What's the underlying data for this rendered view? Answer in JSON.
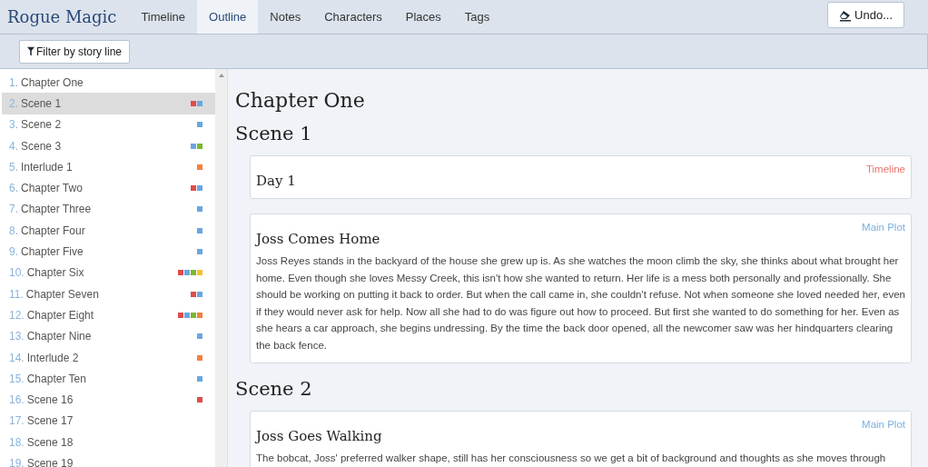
{
  "app": {
    "title": "Rogue Magic"
  },
  "tabs": [
    {
      "label": "Timeline",
      "selected": false
    },
    {
      "label": "Outline",
      "selected": true
    },
    {
      "label": "Notes",
      "selected": false
    },
    {
      "label": "Characters",
      "selected": false
    },
    {
      "label": "Places",
      "selected": false
    },
    {
      "label": "Tags",
      "selected": false
    }
  ],
  "undo_button": {
    "label": "Undo..."
  },
  "filter_button": {
    "label": "Filter by story line"
  },
  "outline": [
    {
      "number": "1.",
      "title": "Chapter One",
      "selected": false
    },
    {
      "number": "2.",
      "title": "Scene 1",
      "selected": true,
      "tags": [
        {
          "color": "#e04b4b"
        },
        {
          "color": "#6aa6e0"
        }
      ]
    },
    {
      "number": "3.",
      "title": "Scene 2",
      "selected": false,
      "tags": [
        {
          "color": "#6aa6e0"
        }
      ]
    },
    {
      "number": "4.",
      "title": "Scene 3",
      "selected": false,
      "tags": [
        {
          "color": "#6aa6e0"
        },
        {
          "color": "#7ab82e"
        }
      ]
    },
    {
      "number": "5.",
      "title": "Interlude 1",
      "selected": false,
      "tags": [
        {
          "color": "#f5803e"
        }
      ]
    },
    {
      "number": "6.",
      "title": "Chapter Two",
      "selected": false,
      "tags": [
        {
          "color": "#e04b4b"
        },
        {
          "color": "#6aa6e0"
        }
      ]
    },
    {
      "number": "7.",
      "title": "Chapter Three",
      "selected": false,
      "tags": [
        {
          "color": "#6aa6e0"
        }
      ]
    },
    {
      "number": "8.",
      "title": "Chapter Four",
      "selected": false,
      "tags": [
        {
          "color": "#6aa6e0"
        }
      ]
    },
    {
      "number": "9.",
      "title": "Chapter Five",
      "selected": false,
      "tags": [
        {
          "color": "#6aa6e0"
        }
      ]
    },
    {
      "number": "10.",
      "title": "Chapter Six",
      "selected": false,
      "tags": [
        {
          "color": "#e04b4b"
        },
        {
          "color": "#6aa6e0"
        },
        {
          "color": "#7ab82e"
        },
        {
          "color": "#f5c02b"
        }
      ]
    },
    {
      "number": "11.",
      "title": "Chapter Seven",
      "selected": false,
      "tags": [
        {
          "color": "#e04b4b"
        },
        {
          "color": "#6aa6e0"
        }
      ]
    },
    {
      "number": "12.",
      "title": "Chapter Eight",
      "selected": false,
      "tags": [
        {
          "color": "#e04b4b"
        },
        {
          "color": "#6aa6e0"
        },
        {
          "color": "#7ab82e"
        },
        {
          "color": "#f5803e"
        }
      ]
    },
    {
      "number": "13.",
      "title": "Chapter Nine",
      "selected": false,
      "tags": [
        {
          "color": "#6aa6e0"
        }
      ]
    },
    {
      "number": "14.",
      "title": "Interlude 2",
      "selected": false,
      "tags": [
        {
          "color": "#f5803e"
        }
      ]
    },
    {
      "number": "15.",
      "title": "Chapter Ten",
      "selected": false,
      "tags": [
        {
          "color": "#6aa6e0"
        }
      ]
    },
    {
      "number": "16.",
      "title": "Scene 16",
      "selected": false,
      "tags": [
        {
          "color": "#e04b4b"
        }
      ]
    },
    {
      "number": "17.",
      "title": "Scene 17",
      "selected": false
    },
    {
      "number": "18.",
      "title": "Scene 18",
      "selected": false
    },
    {
      "number": "19.",
      "title": "Scene 19",
      "selected": false
    }
  ],
  "content": [
    {
      "kind": "chapter",
      "title": "Chapter One"
    },
    {
      "kind": "scene",
      "title": "Scene 1"
    },
    {
      "kind": "card",
      "title": "Day 1",
      "story_line": "Timeline",
      "color": "#e8736b"
    },
    {
      "kind": "card",
      "title": "Joss Comes Home",
      "story_line": "Main Plot",
      "color": "#7ab0e0",
      "text": "Joss Reyes stands in the backyard of the house she grew up is. As she watches the moon climb the sky, she thinks about what brought her home. Even though she loves Messy Creek, this isn't how she wanted to return. Her life is a mess both personally and professionally. She should be working on putting it back to order. But when the call came in, she couldn't refuse. Not when someone she loved needed her, even if they would never ask for help. Now all she had to do was figure out how to proceed. But first she wanted to do something for her. Even as she hears a car approach, she begins undressing. By the time the back door opened, all the newcomer saw was her hindquarters clearing the back fence."
    },
    {
      "kind": "scene",
      "title": "Scene 2"
    },
    {
      "kind": "card",
      "title": "Joss Goes Walking",
      "story_line": "Main Plot",
      "color": "#7ab0e0",
      "text": "The bobcat, Joss' preferred walker shape, still has her consciousness so we get a bit of background and thoughts as she moves through"
    }
  ]
}
